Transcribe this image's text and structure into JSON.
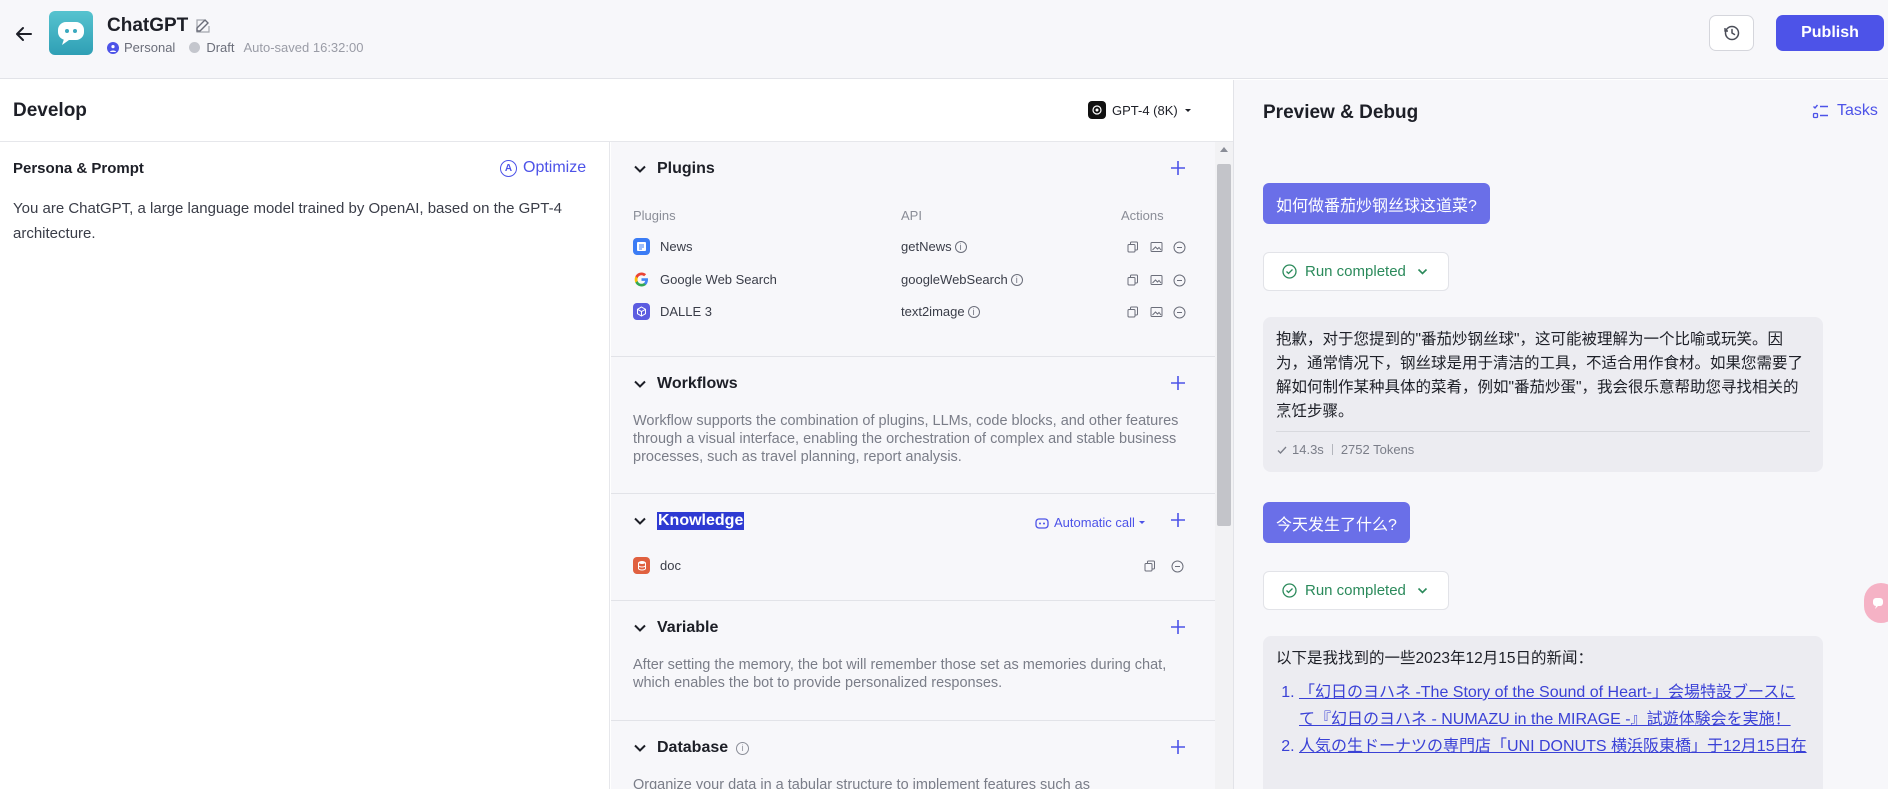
{
  "header": {
    "title": "ChatGPT",
    "space": "Personal",
    "status": "Draft",
    "autosave": "Auto-saved 16:32:00",
    "publish_label": "Publish"
  },
  "develop": {
    "title": "Develop",
    "model": "GPT-4 (8K)"
  },
  "persona": {
    "title": "Persona & Prompt",
    "optimize_label": "Optimize",
    "prompt": "You are ChatGPT, a large language model trained by OpenAI, based on the GPT-4 architecture."
  },
  "plugins": {
    "title": "Plugins",
    "columns": [
      "Plugins",
      "API",
      "Actions"
    ],
    "rows": [
      {
        "name": "News",
        "api": "getNews",
        "icon": "news-icon",
        "color": "#3b7cf5"
      },
      {
        "name": "Google Web Search",
        "api": "googleWebSearch",
        "icon": "google-icon",
        "color": "#ea4335"
      },
      {
        "name": "DALLE 3",
        "api": "text2image",
        "icon": "dalle-icon",
        "color": "#5c5ce0"
      }
    ]
  },
  "workflows": {
    "title": "Workflows",
    "description": "Workflow supports the combination of plugins, LLMs, code blocks, and other features through a visual interface, enabling the orchestration of complex and stable business processes, such as travel planning, report analysis."
  },
  "knowledge": {
    "title": "Knowledge",
    "call_mode": "Automatic call",
    "items": [
      {
        "name": "doc",
        "icon": "document-icon",
        "color": "#e0603f"
      }
    ]
  },
  "variable": {
    "title": "Variable",
    "description": "After setting the memory, the bot will remember those set as memories during chat, which enables the bot to provide personalized responses."
  },
  "database": {
    "title": "Database",
    "description": "Organize your data in a tabular structure to implement features such as"
  },
  "preview": {
    "title": "Preview & Debug",
    "tasks_label": "Tasks",
    "messages": [
      {
        "question": "如何做番茄炒钢丝球这道菜?",
        "run_status": "Run completed",
        "answer": "抱歉，对于您提到的\"番茄炒钢丝球\"，这可能被理解为一个比喻或玩笑。因为，通常情况下，钢丝球是用于清洁的工具，不适合用作食材。如果您需要了解如何制作某种具体的菜肴，例如\"番茄炒蛋\"，我会很乐意帮助您寻找相关的烹饪步骤。",
        "duration": "14.3s",
        "tokens": "2752 Tokens"
      },
      {
        "question": "今天发生了什么?",
        "run_status": "Run completed",
        "answer_intro": "以下是我找到的一些2023年12月15日的新闻：",
        "news": [
          "「幻日のヨハネ -The Story of the Sound of Heart-」会場特設ブースにて『幻日のヨハネ - NUMAZU in the MIRAGE -』試遊体験会を実施！",
          "人気の生ドーナツの専門店「UNI DONUTS 横浜阪東橋」于12月15日在"
        ]
      }
    ]
  },
  "colors": {
    "accent": "#4d53e8",
    "user_bubble": "#6a6fe8",
    "success": "#2b8a5b"
  }
}
